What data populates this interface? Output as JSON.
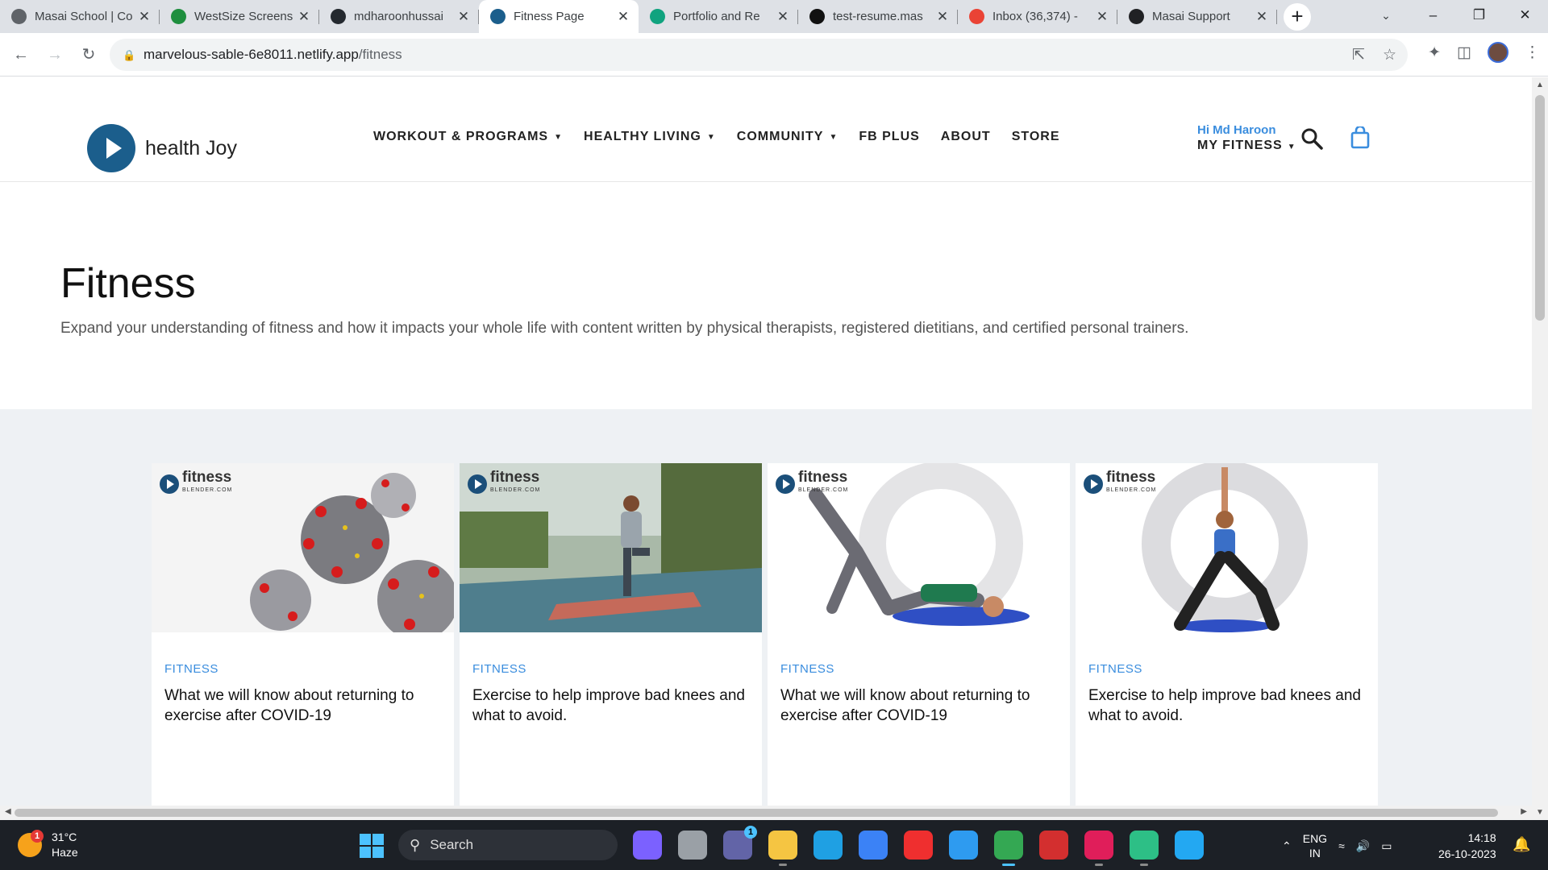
{
  "browser": {
    "tabs": [
      {
        "label": "Masai School | Co",
        "favicon": "masai-icon",
        "color": "#5f6368",
        "active": false
      },
      {
        "label": "WestSize Screens",
        "favicon": "drive-icon",
        "color": "#1e8e3e",
        "active": false
      },
      {
        "label": "mdharoonhussai",
        "favicon": "github-icon",
        "color": "#24292f",
        "active": false
      },
      {
        "label": "Fitness Page",
        "favicon": "fitness-icon",
        "color": "#1b5e8c",
        "active": true
      },
      {
        "label": "Portfolio and Re",
        "favicon": "openai-icon",
        "color": "#10a37f",
        "active": false
      },
      {
        "label": "test-resume.mas",
        "favicon": "netlify-icon",
        "color": "#111111",
        "active": false
      },
      {
        "label": "Inbox (36,374) - ",
        "favicon": "gmail-icon",
        "color": "#ea4335",
        "active": false
      },
      {
        "label": "Masai Support",
        "favicon": "masai-support-icon",
        "color": "#202124",
        "active": false
      }
    ],
    "url_host": "marvelous-sable-6e8011.netlify.app",
    "url_path": "/fitness"
  },
  "site": {
    "logo_text": "health Joy",
    "nav": [
      {
        "label": "WORKOUT & PROGRAMS",
        "dropdown": true
      },
      {
        "label": "HEALTHY LIVING",
        "dropdown": true
      },
      {
        "label": "COMMUNITY",
        "dropdown": true
      },
      {
        "label": "FB PLUS",
        "dropdown": false
      },
      {
        "label": "ABOUT",
        "dropdown": false
      },
      {
        "label": "STORE",
        "dropdown": false
      }
    ],
    "greeting": "Hi Md Haroon",
    "account_label": "MY FITNESS"
  },
  "hero": {
    "title": "Fitness",
    "description": "Expand your understanding of fitness and how it impacts your whole life with content written by physical therapists, registered dietitians, and certified personal trainers."
  },
  "cards": [
    {
      "category": "FITNESS",
      "title": "What we will know about returning to exercise after COVID-19",
      "brand": "fitness",
      "brand_sub": "BLENDER.COM",
      "image": "virus-image"
    },
    {
      "category": "FITNESS",
      "title": "Exercise to help improve bad knees and what to avoid.",
      "brand": "fitness",
      "brand_sub": "BLENDER.COM",
      "image": "yoga-tree-pose-image"
    },
    {
      "category": "FITNESS",
      "title": "What we will know about returning to exercise after COVID-19",
      "brand": "fitness",
      "brand_sub": "BLENDER.COM",
      "image": "glute-bridge-image"
    },
    {
      "category": "FITNESS",
      "title": "Exercise to help improve bad knees and what to avoid.",
      "brand": "fitness",
      "brand_sub": "BLENDER.COM",
      "image": "warrior-pose-image"
    }
  ],
  "taskbar": {
    "weather_temp": "31°C",
    "weather_desc": "Haze",
    "weather_badge": "1",
    "search_label": "Search",
    "lang_top": "ENG",
    "lang_bottom": "IN",
    "time": "14:18",
    "date": "26-10-2023",
    "apps": [
      {
        "name": "copilot-preview-icon",
        "color": "#7b61ff",
        "state": ""
      },
      {
        "name": "task-view-icon",
        "color": "#9aa0a6",
        "state": ""
      },
      {
        "name": "teams-chat-icon",
        "color": "#6264a7",
        "state": "",
        "badge": "1"
      },
      {
        "name": "file-explorer-icon",
        "color": "#f5c542",
        "state": "run"
      },
      {
        "name": "edge-icon",
        "color": "#1fa0e3",
        "state": ""
      },
      {
        "name": "ms-store-icon",
        "color": "#3b82f6",
        "state": ""
      },
      {
        "name": "anydesk-icon",
        "color": "#ef2f2f",
        "state": ""
      },
      {
        "name": "help-icon",
        "color": "#2e9bf0",
        "state": ""
      },
      {
        "name": "chrome-icon",
        "color": "#34a853",
        "state": "act"
      },
      {
        "name": "game-app-icon",
        "color": "#d32f2f",
        "state": ""
      },
      {
        "name": "slack-icon",
        "color": "#e01e5a",
        "state": "run"
      },
      {
        "name": "git-icon",
        "color": "#2dbf86",
        "state": "run"
      },
      {
        "name": "vscode-icon",
        "color": "#23a8f2",
        "state": ""
      }
    ]
  },
  "colors": {
    "accent": "#3a8dde",
    "logo": "#1b5e8c",
    "card_bg_area": "#eef1f4"
  }
}
